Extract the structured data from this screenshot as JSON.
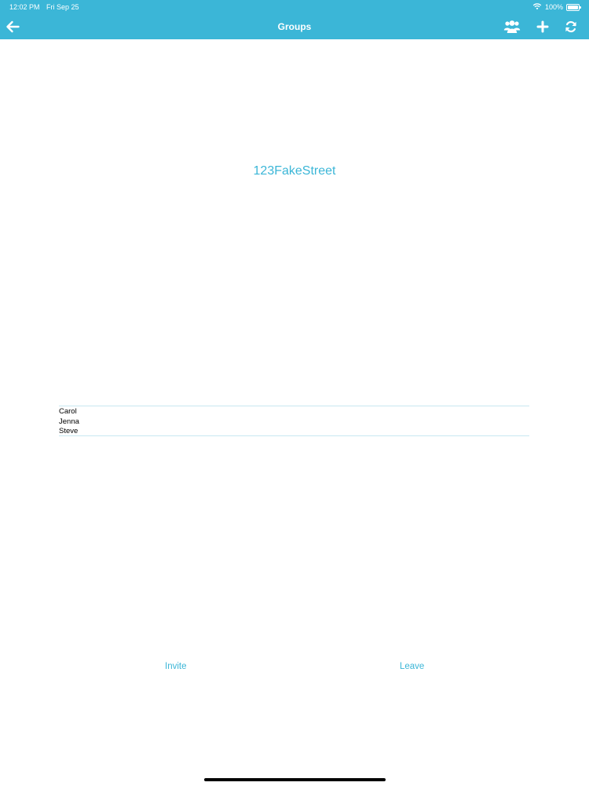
{
  "status_bar": {
    "time": "12:02 PM",
    "date": "Fri Sep 25",
    "battery": "100%"
  },
  "nav": {
    "title": "Groups",
    "icons": [
      "arrow-left-icon",
      "users-icon",
      "plus-icon",
      "refresh-icon"
    ]
  },
  "group": {
    "name": "123FakeStreet"
  },
  "members": [
    "Carol",
    "Jenna",
    "Steve"
  ],
  "actions": {
    "invite_label": "Invite",
    "leave_label": "Leave"
  },
  "colors": {
    "accent": "#3bb6d7",
    "divider": "#c8e7f1",
    "background": "#ffffff"
  }
}
